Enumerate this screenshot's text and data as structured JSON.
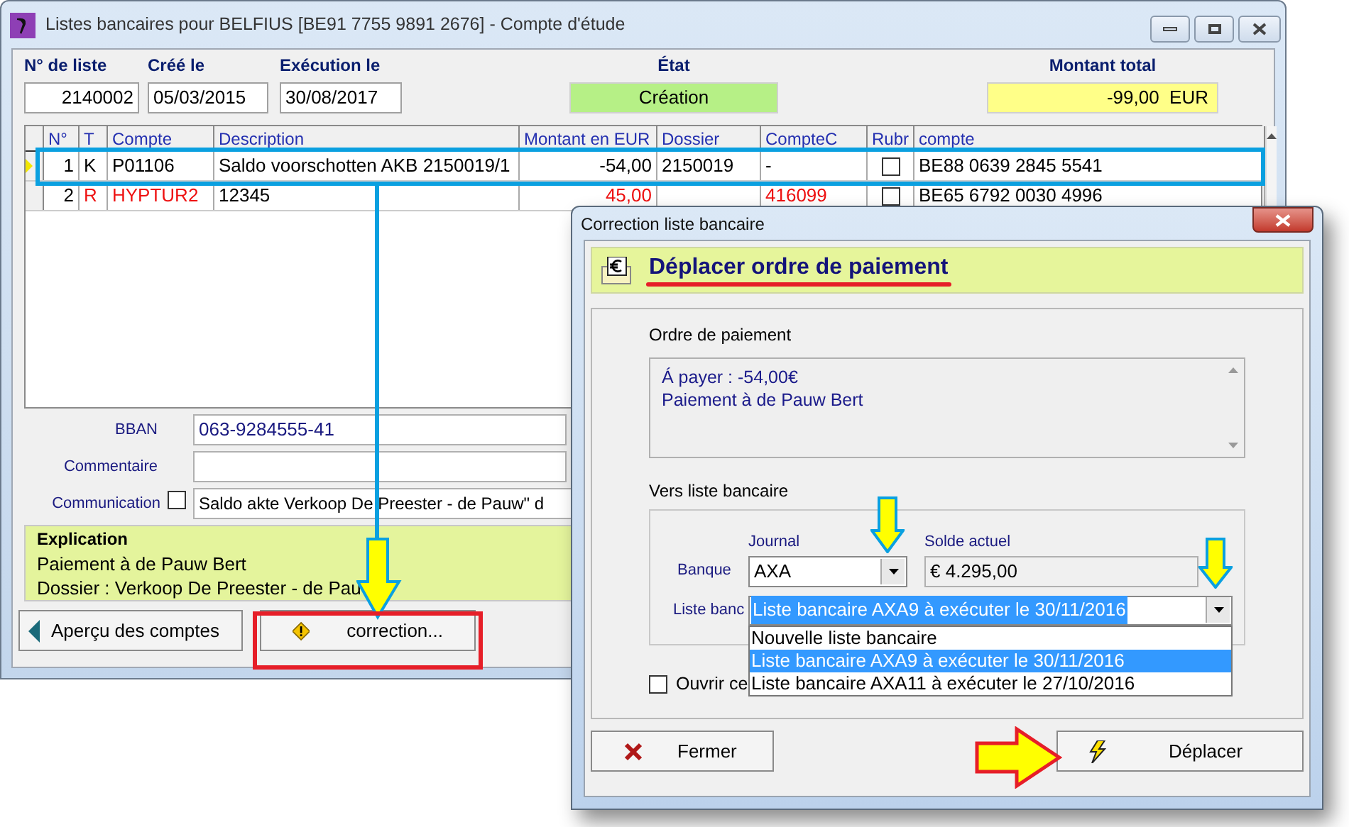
{
  "window": {
    "title": "Listes bancaires pour BELFIUS [BE91 7755 9891 2676] - Compte d'étude"
  },
  "header": {
    "list_no": {
      "label": "N° de liste",
      "value": "2140002"
    },
    "created": {
      "label": "Créé le",
      "value": "05/03/2015"
    },
    "execution": {
      "label": "Exécution le",
      "value": "30/08/2017"
    },
    "state": {
      "label": "État",
      "value": "Création"
    },
    "total": {
      "label": "Montant total",
      "value": "-99,00  EUR"
    }
  },
  "table": {
    "columns": [
      "N°",
      "T",
      "Compte",
      "Description",
      "Montant en EUR",
      "Dossier",
      "CompteC",
      "Rubr",
      "compte"
    ],
    "rows": [
      {
        "selected": true,
        "warning": false,
        "checked": false,
        "cells": [
          "1",
          "K",
          "P01106",
          "Saldo voorschotten AKB 2150019/1",
          "-54,00",
          "2150019",
          "-",
          "",
          "BE88 0639 2845 5541"
        ]
      },
      {
        "selected": false,
        "warning": true,
        "checked": false,
        "cells": [
          "2",
          "R",
          "HYPTUR2",
          "12345",
          "45,00",
          "",
          "416099",
          "",
          "BE65 6792 0030 4996"
        ]
      }
    ]
  },
  "details": {
    "bban": {
      "label": "BBAN",
      "value": "063-9284555-41"
    },
    "comment": {
      "label": "Commentaire"
    },
    "communication": {
      "label": "Communication",
      "checked": false,
      "value": "Saldo akte Verkoop De Preester - de Pauw\" d"
    }
  },
  "explanation": {
    "title": "Explication",
    "lines": [
      "Paiement à de Pauw Bert",
      "Dossier : Verkoop De Preester - de Pau"
    ]
  },
  "buttons": [
    "Aperçu des comptes",
    "correction..."
  ],
  "dialog": {
    "title": "Correction liste bancaire",
    "heading": "Déplacer ordre de paiement",
    "payment_order": {
      "label": "Ordre de paiement",
      "lines": [
        "Á payer : -54,00€",
        "Paiement à de Pauw Bert"
      ]
    },
    "target": {
      "label": "Vers liste bancaire",
      "journal_label": "Journal",
      "balance_label": "Solde actuel",
      "bank_label": "Banque",
      "bank_value": "AXA",
      "balance_value": "€ 4.295,00",
      "list_label": "Liste banc",
      "list_value": "Liste bancaire AXA9 à exécuter le 30/11/2016",
      "options": [
        {
          "label": "Nouvelle liste bancaire",
          "selected": false
        },
        {
          "label": "Liste bancaire AXA9 à exécuter le 30/11/2016",
          "selected": true
        },
        {
          "label": "Liste bancaire AXA11 à exécuter le 27/10/2016",
          "selected": false
        }
      ]
    },
    "open_checkbox": {
      "label": "Ouvrir ce",
      "checked": false
    },
    "buttons": [
      "Fermer",
      "Déplacer"
    ]
  }
}
